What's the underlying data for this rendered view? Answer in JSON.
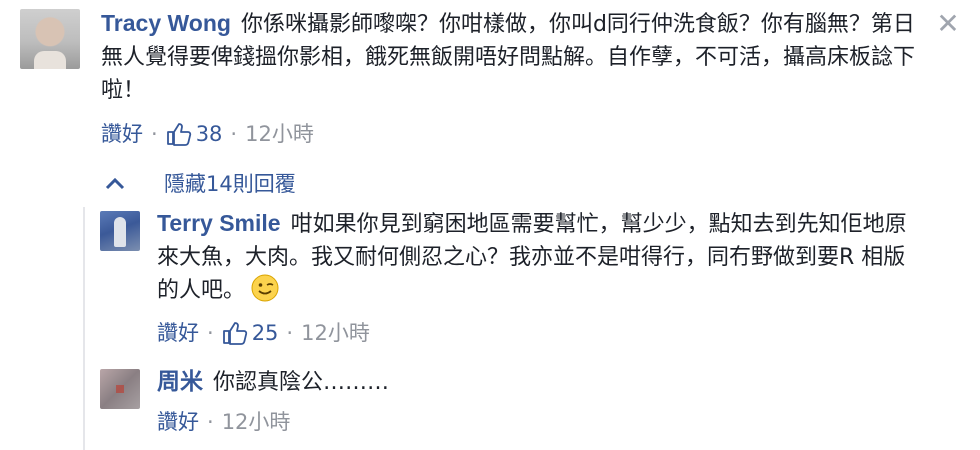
{
  "comment1": {
    "author": "Tracy Wong",
    "text": "你係咪攝影師嚟㗎？你咁樣做，你叫d同行仲洗食飯？你有腦無？第日無人覺得要俾錢搵你影相，餓死無飯開唔好問點解。自作孽，不可活，攝高床板諗下啦！",
    "like_label": "讚好",
    "separator": "·",
    "like_count": "38",
    "time": "12小時"
  },
  "replies_toggle": {
    "label": "隱藏14則回覆"
  },
  "comment2": {
    "author": "Terry Smile",
    "text": "咁如果你見到窮困地區需要幫忙，幫少少，點知去到先知佢地原來大魚，大肉。我又耐何側忍之心？我亦並不是咁得行，同冇野做到要R 相版的人吧。",
    "emoji": "wink-emoji",
    "like_label": "讚好",
    "separator": "·",
    "like_count": "25",
    "time": "12小時"
  },
  "comment3": {
    "author": "周米",
    "text": "你認真陰公………",
    "like_label": "讚好",
    "separator": "·",
    "time": "12小時"
  },
  "icons": {
    "close": "close-icon",
    "chevron": "chevron-up-icon",
    "thumb": "thumbs-up-icon"
  },
  "colors": {
    "link": "#365899",
    "meta": "#90949c",
    "text": "#1d2129"
  }
}
